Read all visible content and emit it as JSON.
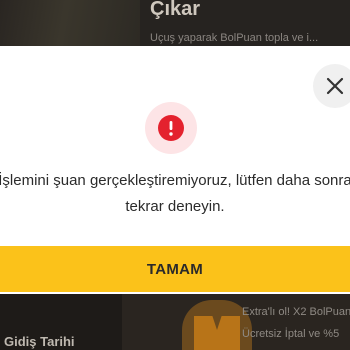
{
  "background": {
    "top_card": {
      "title": "Çıkar",
      "subtitle": "Uçuş yaparak BolPuan topla ve i..."
    },
    "bottom_card": {
      "label": "Gidiş Tarihi",
      "line1": "Extra'lı ol! X2 BolPuan",
      "line2": "Ücretsiz İptal ve %5"
    }
  },
  "modal": {
    "close_icon": "close-icon",
    "alert_icon": "exclamation-icon",
    "message_line1": "İşlemini şuan gerçekleştiremiyoruz, lütfen daha sonra",
    "message_line2": "tekrar deneyin.",
    "ok_label": "TAMAM"
  },
  "colors": {
    "accent": "#fbc21a",
    "error": "#e4222e",
    "error_tint": "#fde4e6"
  }
}
